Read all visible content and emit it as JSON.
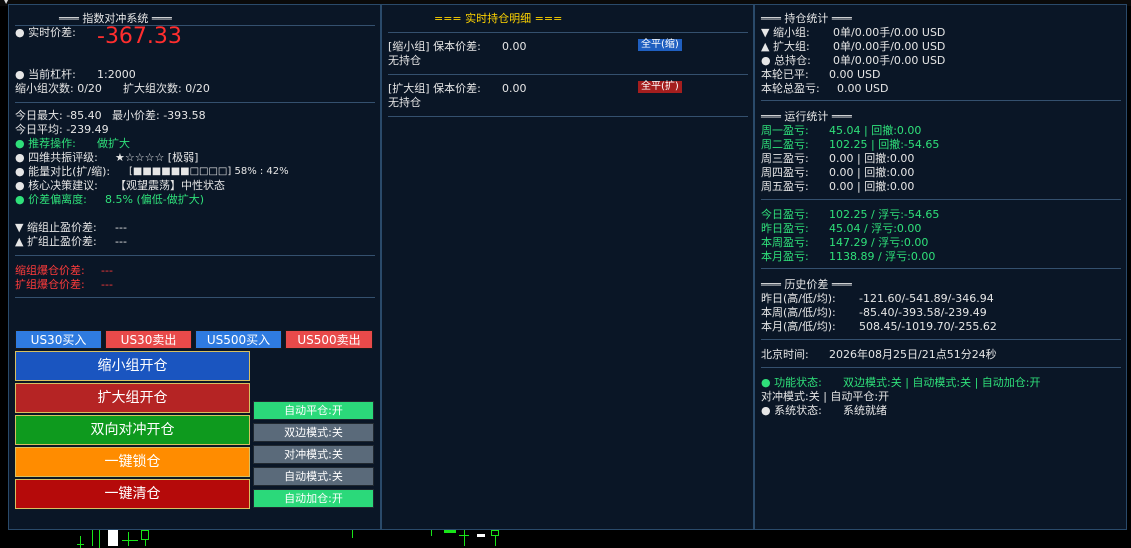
{
  "left": {
    "title": "═══ 指数对冲系统 ═══",
    "realtime_spread_label": "● 实时价差:",
    "realtime_spread_value": "-367.33",
    "leverage_label": "● 当前杠杆:",
    "leverage_value": "1:2000",
    "shrink_count": "缩小组次数: 0/20",
    "expand_count": "扩大组次数: 0/20",
    "today_max": "今日最大: -85.40",
    "min_spread": "最小价差: -393.58",
    "today_avg": "今日平均: -239.49",
    "recommend_label": "● 推荐操作:",
    "recommend_value": "做扩大",
    "resonance_label": "● 四维共振评级:",
    "resonance_value": "★☆☆☆☆ [极弱]",
    "energy_label": "● 能量对比(扩/缩):",
    "energy_value": "[■■■■■■□□□□] 58% : 42%",
    "core_label": "● 核心决策建议:",
    "core_value": "【观望震荡】中性状态",
    "deviation_label": "● 价差偏离度:",
    "deviation_value": "8.5% (偏低-做扩大)",
    "shrink_tp_label": "▼ 缩组止盈价差:",
    "shrink_tp_value": "---",
    "expand_tp_label": "▲ 扩组止盈价差:",
    "expand_tp_value": "---",
    "shrink_liq_label": "缩组爆仓价差:",
    "shrink_liq_value": "---",
    "expand_liq_label": "扩组爆仓价差:",
    "expand_liq_value": "---"
  },
  "buttons": {
    "us30_buy": "US30买入",
    "us30_sell": "US30卖出",
    "us500_buy": "US500买入",
    "us500_sell": "US500卖出",
    "open_shrink": "缩小组开仓",
    "open_expand": "扩大组开仓",
    "open_hedge": "双向对冲开仓",
    "lock": "一键锁仓",
    "close_all": "一键清仓",
    "auto_close": "自动平仓:开",
    "bilateral": "双边模式:关",
    "hedge_mode": "对冲模式:关",
    "auto_mode": "自动模式:关",
    "auto_add": "自动加仓:开"
  },
  "mid": {
    "title": "=== 实时持仓明细 ===",
    "shrink_line": "[缩小组] 保本价差:",
    "shrink_breakeven": "0.00",
    "shrink_close_btn": "全平(缩)",
    "shrink_status": "无持仓",
    "expand_line": "[扩大组] 保本价差:",
    "expand_breakeven": "0.00",
    "expand_close_btn": "全平(扩)",
    "expand_status": "无持仓"
  },
  "right": {
    "pos_title": "═══ 持仓统计 ═══",
    "pos_shrink_label": "▼ 缩小组:",
    "pos_shrink_value": "0单/0.00手/0.00 USD",
    "pos_expand_label": "▲ 扩大组:",
    "pos_expand_value": "0单/0.00手/0.00 USD",
    "pos_total_label": "● 总持仓:",
    "pos_total_value": "0单/0.00手/0.00 USD",
    "round_closed_label": "本轮已平:",
    "round_closed_value": "0.00 USD",
    "round_total_label": "本轮总盈亏:",
    "round_total_value": "0.00 USD",
    "run_title": "═══ 运行统计 ═══",
    "weekdays": [
      {
        "label": "周一盈亏:",
        "value": "45.04 | 回撤:0.00",
        "color": "green"
      },
      {
        "label": "周二盈亏:",
        "value": "102.25 | 回撤:-54.65",
        "color": "green"
      },
      {
        "label": "周三盈亏:",
        "value": "0.00 | 回撤:0.00",
        "color": "white"
      },
      {
        "label": "周四盈亏:",
        "value": "0.00 | 回撤:0.00",
        "color": "white"
      },
      {
        "label": "周五盈亏:",
        "value": "0.00 | 回撤:0.00",
        "color": "white"
      }
    ],
    "periods": [
      {
        "label": "今日盈亏:",
        "value": "102.25 / 浮亏:-54.65"
      },
      {
        "label": "昨日盈亏:",
        "value": "45.04 / 浮亏:0.00"
      },
      {
        "label": "本周盈亏:",
        "value": "147.29 / 浮亏:0.00"
      },
      {
        "label": "本月盈亏:",
        "value": "1138.89 / 浮亏:0.00"
      }
    ],
    "hist_title": "═══ 历史价差 ═══",
    "hist": [
      {
        "label": "昨日(高/低/均):",
        "value": "-121.60/-541.89/-346.94"
      },
      {
        "label": "本周(高/低/均):",
        "value": "-85.40/-393.58/-239.49"
      },
      {
        "label": "本月(高/低/均):",
        "value": "508.45/-1019.70/-255.62"
      }
    ],
    "beijing_label": "北京时间:",
    "beijing_value": "2026年08月25日/21点51分24秒",
    "func_label": "● 功能状态:",
    "func_value": "双边模式:关 | 自动模式:关 | 自动加仓:开",
    "func_line2": "对冲模式:关 | 自动平仓:开",
    "sys_label": "● 系统状态:",
    "sys_value": "系统就绪"
  },
  "colors": {
    "panel_bg": "#0a1626",
    "blue_btn": "#2f7be0",
    "red_btn": "#e84a4a",
    "green_btn": "#2bd97a",
    "slate_btn": "#5a6a7a"
  }
}
